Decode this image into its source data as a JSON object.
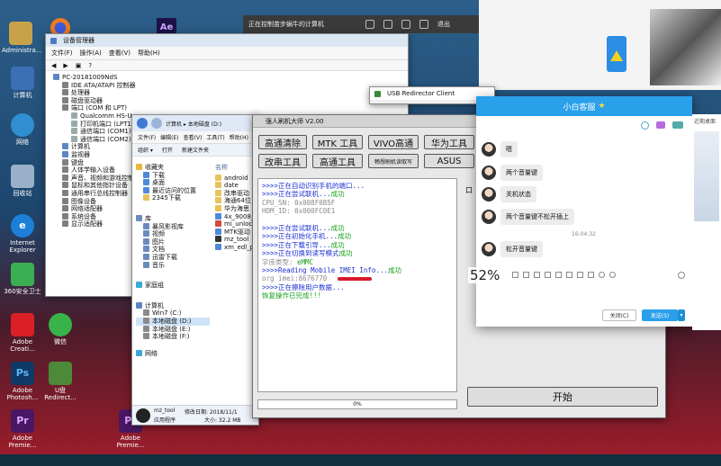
{
  "desktop": {
    "icons": [
      {
        "label": "Administra...",
        "color": "#c8a24a"
      },
      {
        "label": "计算机",
        "color": "#3c6fb6"
      },
      {
        "label": "网络",
        "color": "#2f8fd0"
      },
      {
        "label": "回收站",
        "color": "#9ab0c8"
      },
      {
        "label": "Internet Explorer",
        "color": "#1d7fd8"
      },
      {
        "label": "360安全卫士",
        "color": "#3cae52"
      },
      {
        "label": "Adobe Creati...",
        "color": "#da1f26"
      },
      {
        "label": "微信",
        "color": "#37b34a"
      },
      {
        "label": "Adobe Photosh...",
        "color": "#0f3a66"
      },
      {
        "label": "U盘 Redirect...",
        "color": "#4c8a3a"
      },
      {
        "label": "Adobe Premie...",
        "color": "#4a1764"
      },
      {
        "label": "Adobe Premie...",
        "color": "#4a1764"
      }
    ]
  },
  "remote": {
    "title": "正在控制苗步蜗牛的计算机",
    "exit": "退出"
  },
  "device_manager": {
    "title": "设备管理器",
    "menu": [
      "文件(F)",
      "操作(A)",
      "查看(V)",
      "帮助(H)"
    ],
    "tree": [
      "PC-20181009NdS",
      "IDE ATA/ATAPI 控制器",
      "处理器",
      "磁盘驱动器",
      "端口 (COM 和 LPT)",
      "Qualcomm HS-U",
      "打印机端口 (LPT1",
      "通信端口 (COM1)",
      "通信端口 (COM2)",
      "计算机",
      "监视器",
      "键盘",
      "人体学输入设备",
      "声音、视频和游戏控制",
      "鼠标和其他指针设备",
      "通用串行总线控制器",
      "图像设备",
      "网络适配器",
      "系统设备",
      "显示适配器"
    ]
  },
  "explorer": {
    "path": "计算机 ▸ 本地磁盘 (D:)",
    "menu": [
      "文件(F)",
      "编辑(E)",
      "查看(V)",
      "工具(T)",
      "帮助(H)"
    ],
    "toolbar": [
      "组织 ▾",
      "打开",
      "新建文件夹"
    ],
    "nav": [
      "收藏夹",
      "下载",
      "桌面",
      "最近访问的位置",
      "2345下载",
      "库",
      "暴风影视库",
      "视频",
      "图片",
      "文档",
      "迅雷下载",
      "音乐",
      "家庭组",
      "计算机",
      "Win7 (C:)",
      "本地磁盘 (D:)",
      "本地磁盘 (E:)",
      "本地磁盘 (F:)",
      "网络"
    ],
    "column": "名称",
    "files": [
      "android",
      "date",
      "改串驱动",
      "海通64位",
      "华为海思",
      "4x_9008_",
      "mi_unloc",
      "MTK驱动",
      "mz_tool",
      "xm_edl_p"
    ],
    "status_name": "mz_tool",
    "status_date": "修改日期: 2018/11/1",
    "status_kind": "应用程序",
    "status_size": "大小: 32.2 MB"
  },
  "usb": {
    "title": "USB Redirector Client"
  },
  "flash_tool": {
    "title": "强人刷机大师 V2.00",
    "buttons_row1": [
      "高通清除",
      "MTK 工具",
      "VIVO高通",
      "华为工具"
    ],
    "buttons_row2": [
      "改串工具",
      "高通工具",
      "畅想刷机读取写",
      "ASUS"
    ],
    "log": [
      {
        "text": ">>>>正在自动识别手机的端口...",
        "cls": "blue"
      },
      {
        "text": ">>>>正在尝试联机...",
        "cls": "blue",
        "ok": "成功"
      },
      {
        "text": "    CPU_SN:  0x008F0B5F",
        "cls": "gry"
      },
      {
        "text": "    HDM_ID:  0x000FC0E1",
        "cls": "gry"
      },
      {
        "text": "",
        "cls": "blue"
      },
      {
        "text": ">>>>正在尝试联机...",
        "cls": "blue",
        "ok": "成功"
      },
      {
        "text": ">>>>正在初始化手机...",
        "cls": "blue",
        "ok": "成功"
      },
      {
        "text": ">>>>正在下载引导...",
        "cls": "blue",
        "ok": "成功"
      },
      {
        "text": ">>>>正在切换到读写模式",
        "cls": "blue",
        "ok": "成功"
      },
      {
        "text": "    字库类型: ",
        "cls": "gry",
        "ok": "eMMC"
      },
      {
        "text": ">>>>Reading Mobile IMEI Info...",
        "cls": "blue",
        "ok": "成功"
      },
      {
        "text": "    org imei:8676770",
        "cls": "gry"
      },
      {
        "text": ">>>>正在擦除用户数据...",
        "cls": "blue"
      },
      {
        "text": "    恢复操作已完成!!!",
        "cls": "grn"
      }
    ],
    "progress": "0%",
    "right_label": "口",
    "start_button": "开始"
  },
  "chat": {
    "title": "小白客服",
    "messages": [
      "嗯",
      "两个音量键",
      "关机状态",
      "两个音量键不松开插上",
      "松开音量键"
    ],
    "timestamp": "16:04:32",
    "percent": "52%",
    "close_button": "关闭(C)",
    "send_button": "发送(S)",
    "side_text": "近期桌面"
  },
  "colors": {
    "accent": "#2aa0ea",
    "log_blue": "#1a2fd0",
    "log_green": "#18a018"
  }
}
